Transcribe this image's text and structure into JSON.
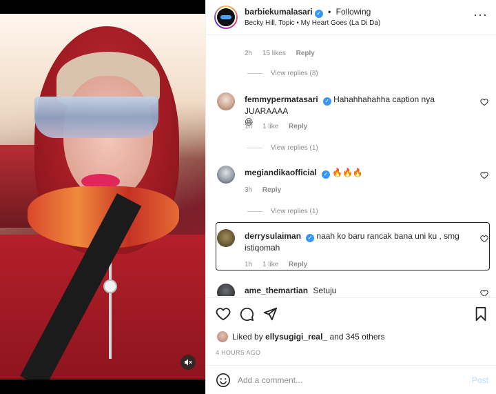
{
  "header": {
    "username": "barbiekumalasari",
    "verified_mark": "✓",
    "separator": "•",
    "follow_state": "Following",
    "music": "Becky Hill, Topic • My Heart Goes (La Di Da)",
    "more_glyph": "···"
  },
  "top_comment_meta": {
    "time": "2h",
    "likes": "15 likes",
    "reply": "Reply",
    "view_replies": "View replies (8)"
  },
  "comments": [
    {
      "username": "femmypermatasari",
      "verified_mark": "✓",
      "text": "Hahahhahahha caption nya JUARAAAA",
      "emoji": "😆",
      "time": "1h",
      "likes": "1 like",
      "reply": "Reply",
      "view_replies": "View replies (1)"
    },
    {
      "username": "megiandikaofficial",
      "verified_mark": "✓",
      "text": "🔥🔥🔥",
      "time": "3h",
      "reply": "Reply",
      "view_replies": "View replies (1)"
    },
    {
      "username": "derrysulaiman",
      "verified_mark": "✓",
      "text": "naah ko baru rancak bana uni ku , smg istiqomah",
      "time": "1h",
      "likes": "1 like",
      "reply": "Reply"
    },
    {
      "username": "ame_themartian",
      "text": "Setuju"
    }
  ],
  "liked_by": {
    "prefix": "Liked by",
    "user": "ellysugigi_real_",
    "suffix": "and 345 others"
  },
  "timestamp": "4 HOURS AGO",
  "add_comment": {
    "placeholder": "Add a comment...",
    "post_label": "Post"
  },
  "icons": {
    "like": "heart-icon",
    "comment": "comment-icon",
    "share": "paper-plane-icon",
    "save": "bookmark-icon",
    "mute": "speaker-muted-icon",
    "emoji": "emoji-icon"
  },
  "colors": {
    "verified": "#3897f0",
    "muted_text": "#8e8e8e",
    "post_disabled": "#b2dffc"
  }
}
